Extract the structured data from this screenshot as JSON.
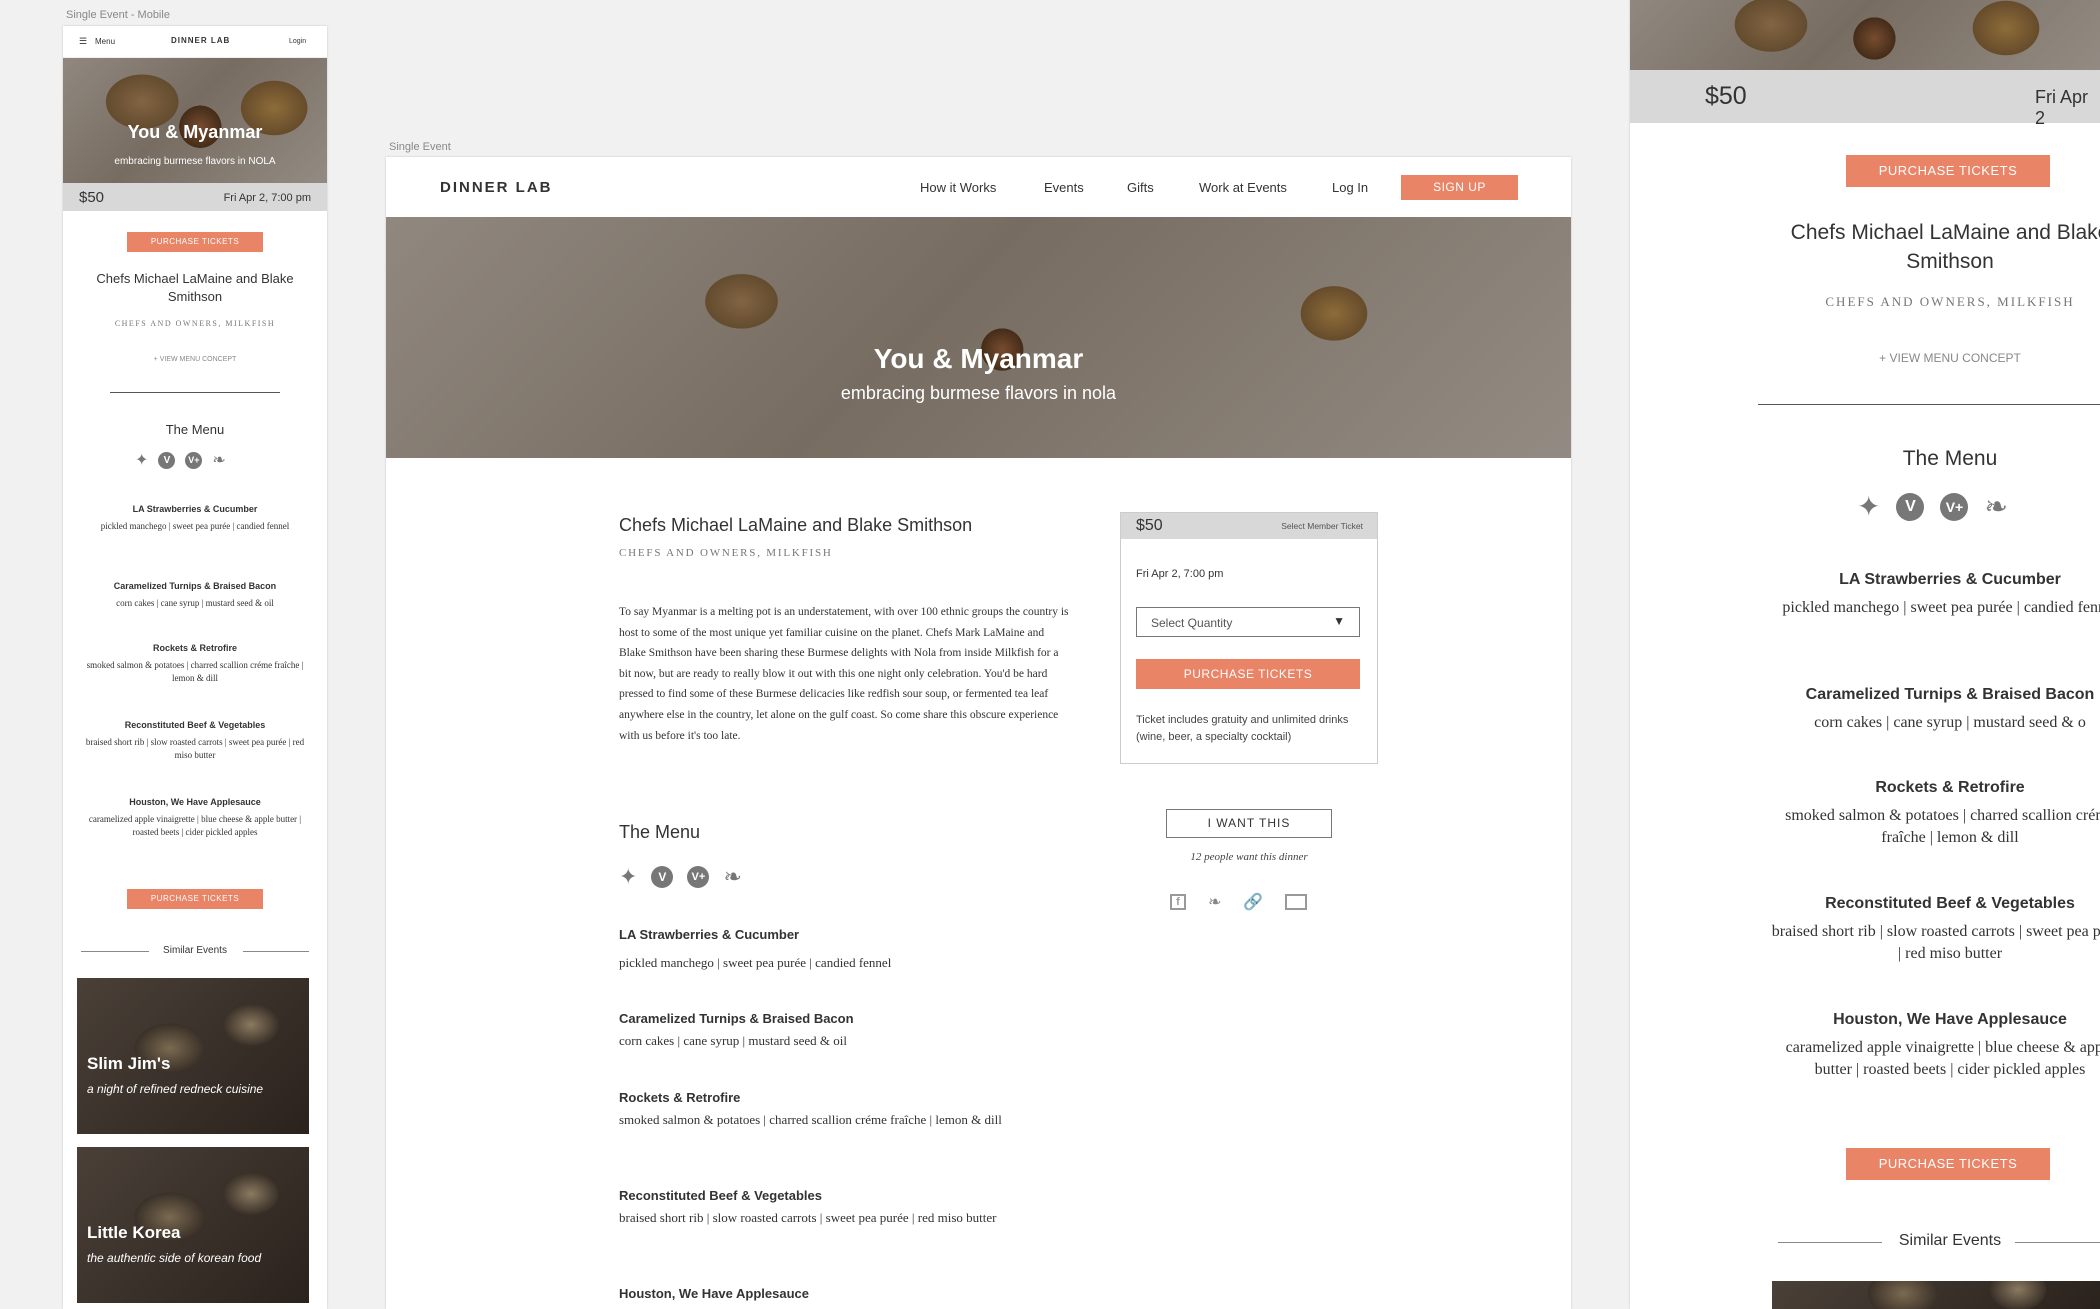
{
  "artboards": {
    "mobile_label": "Single Event - Mobile",
    "desktop_label": "Single Event"
  },
  "brand": {
    "logo": "DINNER LAB",
    "accent": "#e98467"
  },
  "nav": {
    "menu_label": "Menu",
    "login_mobile": "Login",
    "items": [
      "How it Works",
      "Events",
      "Gifts",
      "Work at Events",
      "Log In"
    ],
    "signup": "SIGN UP"
  },
  "event": {
    "title": "You & Myanmar",
    "subtitle_mobile": "embracing burmese flavors in NOLA",
    "subtitle_desktop": "embracing burmese flavors in nola",
    "price": "$50",
    "date_mobile": "Fri Apr 2, 7:00 pm",
    "date_right": "Fri Apr 2",
    "chefs": "Chefs Michael LaMaine and Blake Smithson",
    "chefs_role": "CHEFS AND OWNERS, MILKFISH",
    "view_menu": "+ VIEW MENU CONCEPT",
    "description": "To say Myanmar is a melting pot is an understatement, with over 100 ethnic groups the country is host to some of the most unique yet familiar cuisine on the planet. Chefs Mark LaMaine and Blake Smithson have been sharing these Burmese delights with Nola from inside Milkfish for a bit now, but are ready to really blow it out with this one night only celebration. You'd be hard pressed to find some of these Burmese delicacies like redfish sour soup, or fermented tea leaf anywhere else in the country, let alone on the gulf coast. So come share this obscure experience with us before it's too late."
  },
  "ticket": {
    "price": "$50",
    "member_link": "Select Member Ticket",
    "date": "Fri Apr 2, 7:00 pm",
    "quantity_placeholder": "Select Quantity",
    "purchase": "PURCHASE TICKETS",
    "note": "Ticket includes gratuity and unlimited drinks (wine, beer, a specialty cocktail)"
  },
  "want": {
    "button": "I WANT THIS",
    "count_text": "12 people want this dinner"
  },
  "menu": {
    "heading": "The Menu",
    "icons": [
      "fish-icon",
      "vegetarian-icon",
      "vegan-icon",
      "gluten-free-icon"
    ],
    "courses": [
      {
        "name": "LA Strawberries & Cucumber",
        "desc": "pickled manchego  |  sweet pea purée  |  candied fennel"
      },
      {
        "name": "Caramelized Turnips & Braised Bacon",
        "desc": "corn cakes  | cane syrup  |  mustard seed & oil"
      },
      {
        "name": "Rockets & Retrofire",
        "desc": "smoked salmon & potatoes | charred scallion créme fraîche | lemon & dill"
      },
      {
        "name": "Reconstituted Beef & Vegetables",
        "desc": "braised short rib | slow roasted carrots | sweet pea purée | red miso butter"
      },
      {
        "name": "Houston, We Have Applesauce",
        "desc": "caramelized apple vinaigrette  | blue cheese & apple butter  | roasted beets  | cider pickled apples"
      }
    ],
    "right_desc_2": "corn cakes  | cane syrup  |  mustard seed & o"
  },
  "similar": {
    "heading": "Similar Events",
    "events": [
      {
        "title": "Slim Jim's",
        "tagline": "a night of refined redneck cuisine"
      },
      {
        "title": "Little Korea",
        "tagline": "the authentic side of korean food"
      }
    ]
  }
}
